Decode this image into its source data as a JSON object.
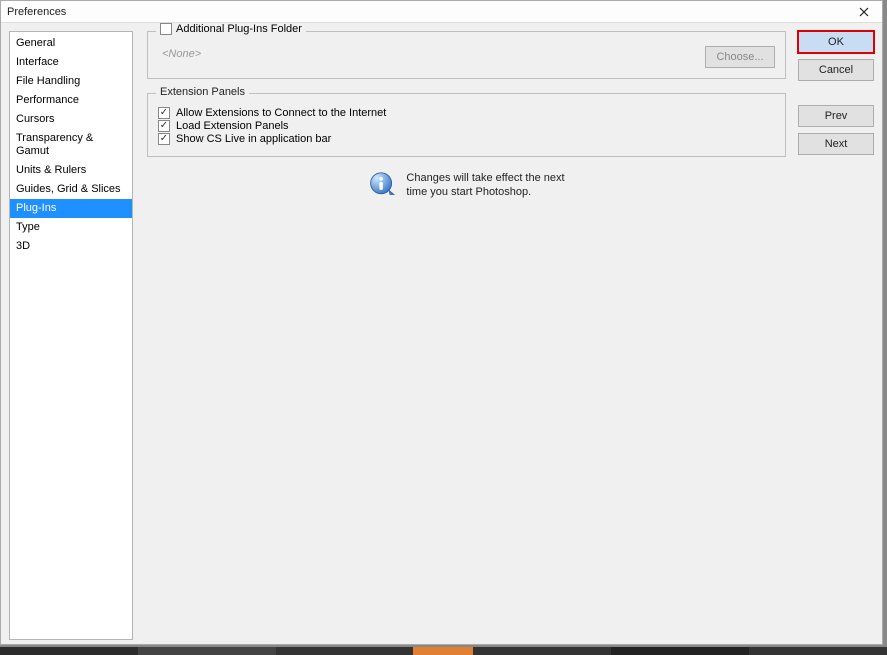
{
  "window": {
    "title": "Preferences"
  },
  "sidebar": {
    "items": [
      {
        "label": "General"
      },
      {
        "label": "Interface"
      },
      {
        "label": "File Handling"
      },
      {
        "label": "Performance"
      },
      {
        "label": "Cursors"
      },
      {
        "label": "Transparency & Gamut"
      },
      {
        "label": "Units & Rulers"
      },
      {
        "label": "Guides, Grid & Slices"
      },
      {
        "label": "Plug-Ins"
      },
      {
        "label": "Type"
      },
      {
        "label": "3D"
      }
    ],
    "selected_index": 8
  },
  "buttons": {
    "ok": "OK",
    "cancel": "Cancel",
    "prev": "Prev",
    "next": "Next",
    "choose": "Choose..."
  },
  "plugins_folder": {
    "legend": "Additional Plug-Ins Folder",
    "checked": false,
    "path_placeholder": "<None>"
  },
  "extension_panels": {
    "legend": "Extension Panels",
    "allow_internet": {
      "label": "Allow Extensions to Connect to the Internet",
      "checked": true
    },
    "load_panels": {
      "label": "Load Extension Panels",
      "checked": true
    },
    "show_cs_live": {
      "label": "Show CS Live in application bar",
      "checked": true
    }
  },
  "info": {
    "line1": "Changes will take effect the next",
    "line2": "time you start Photoshop."
  }
}
